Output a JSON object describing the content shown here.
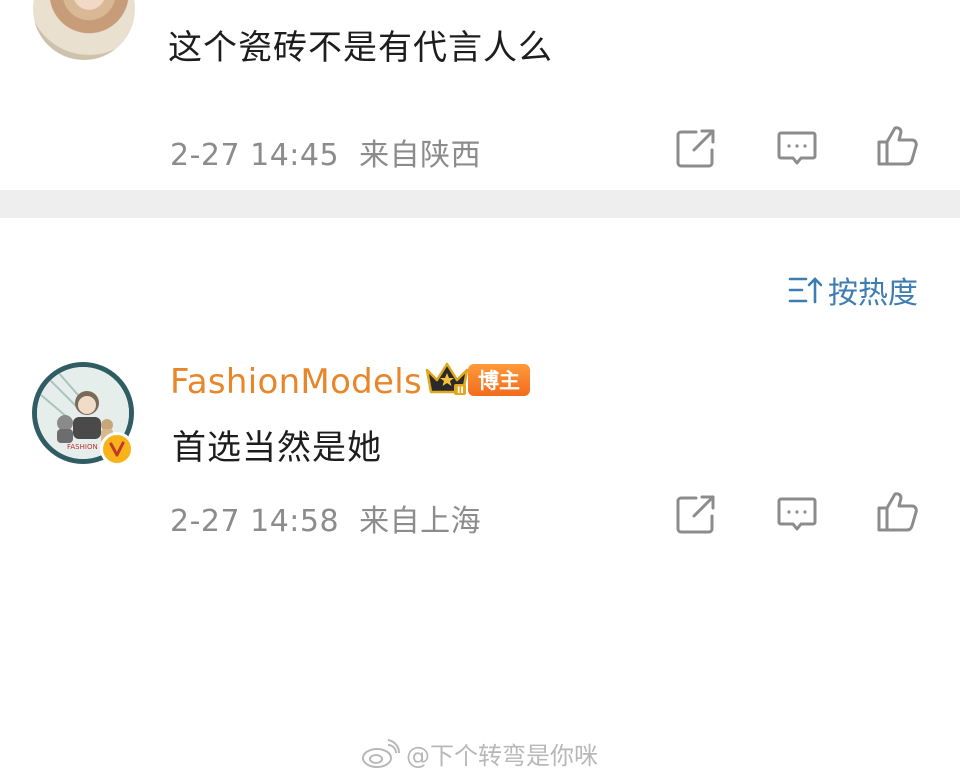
{
  "comments": [
    {
      "text": "这个瓷砖不是有代言人么",
      "time": "2-27 14:45",
      "location": "来自陕西",
      "avatar_icon": "user-avatar-woman-photo"
    },
    {
      "username": "FashionModels",
      "role_badge": "博主",
      "text": "首选当然是她",
      "time": "2-27 14:58",
      "location": "来自上海",
      "avatar_icon": "user-avatar-illustration",
      "verified_icon": "verified-v-icon",
      "crown_icon": "crown-level-icon"
    }
  ],
  "sort": {
    "label": "按热度",
    "icon": "sort-icon"
  },
  "actions": [
    "share-icon",
    "comment-icon",
    "like-icon"
  ],
  "watermark": {
    "text": "@下个转弯是你咪",
    "icon": "weibo-logo-icon"
  },
  "colors": {
    "username": "#e8862b",
    "sort_accent": "#3d7db2",
    "meta_text": "#8c8c8c",
    "divider": "#eeeeee"
  }
}
